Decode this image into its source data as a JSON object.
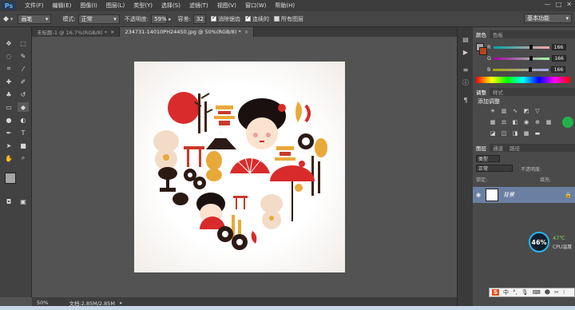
{
  "app": {
    "logo": "Ps"
  },
  "menu": [
    "文件(F)",
    "编辑(E)",
    "图像(I)",
    "图层(L)",
    "类型(Y)",
    "选择(S)",
    "滤镜(T)",
    "视图(V)",
    "窗口(W)",
    "帮助(H)"
  ],
  "window_controls": [
    "—",
    "□",
    "✕"
  ],
  "options": {
    "brush_preset_label": "画笔",
    "mode_label": "模式:",
    "mode_value": "正常",
    "opacity_label": "不透明度:",
    "opacity_value": "59%",
    "flow_label": "容差:",
    "flow_value": "32",
    "antialias_label": "消除锯齿",
    "contiguous_label": "连续的",
    "all_layers_label": "所有图层",
    "workspace": "基本功能"
  },
  "doc_tabs": [
    {
      "title": "未标题-1 @ 16.7%(RGB/8) *",
      "close": "×"
    },
    {
      "title": "234731-14010PH24450.jpg @ 50%(RGB/8) *",
      "close": "×"
    }
  ],
  "status": {
    "zoom": "50%",
    "doc_info": "文档:2.85M/2.85M"
  },
  "color_panel": {
    "tabs": [
      "颜色",
      "色板"
    ],
    "r_label": "R",
    "r_value": "166",
    "g_label": "G",
    "g_value": "166",
    "b_label": "B",
    "b_value": "166",
    "foreground": "#a6a6a6",
    "background": "#b5441c"
  },
  "adjust_panel": {
    "tabs": [
      "调整",
      "样式"
    ],
    "title": "添加调整"
  },
  "layers_panel": {
    "tabs": [
      "图层",
      "通道",
      "路径"
    ],
    "kind_label": "类型",
    "blend_mode": "正常",
    "opacity_label": "不透明度:",
    "lock_label": "锁定:",
    "fill_label": "填充:",
    "layers": [
      {
        "name": "背景"
      }
    ]
  },
  "cpu_widget": {
    "percent": "46%",
    "temp": "47℃",
    "label": "CPU温度"
  },
  "ime": {
    "logo": "S",
    "lang": "中"
  }
}
